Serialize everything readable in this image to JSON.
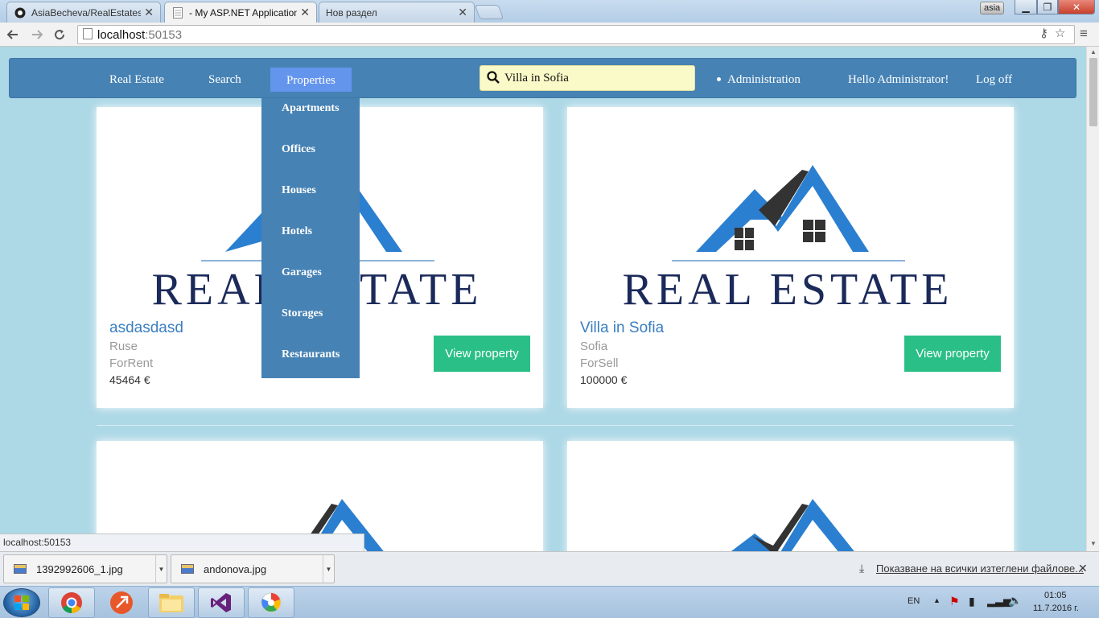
{
  "browser": {
    "tabs": [
      {
        "label": "AsiaBecheva/RealEstates -",
        "active": false
      },
      {
        "label": "- My ASP.NET Application",
        "active": true
      },
      {
        "label": "Нов раздел",
        "active": false
      }
    ],
    "user_badge": "asia",
    "url_host": "localhost",
    "url_port": ":50153"
  },
  "nav": {
    "brand": "Real Estate",
    "search": "Search",
    "properties": "Properties",
    "search_value": "Villa in Sofia",
    "administration": "Administration",
    "hello": "Hello Administrator!",
    "logoff": "Log off"
  },
  "dropdown": [
    "Apartments",
    "Offices",
    "Houses",
    "Hotels",
    "Garages",
    "Storages",
    "Restaurants"
  ],
  "logo_text": "REAL ESTATE",
  "cards": [
    {
      "title": "asdasdasd",
      "city": "Ruse",
      "type": "ForRent",
      "price": "45464 €",
      "button": "View property"
    },
    {
      "title": "Villa in Sofia",
      "city": "Sofia",
      "type": "ForSell",
      "price": "100000 €",
      "button": "View property"
    }
  ],
  "status_url": "localhost:50153",
  "downloads": [
    {
      "name": "1392992606_1.jpg"
    },
    {
      "name": "andonova.jpg"
    }
  ],
  "show_all_downloads": "Показване на всички изтеглени файлове...",
  "taskbar": {
    "lang": "EN",
    "time": "01:05",
    "date": "11.7.2016 г."
  },
  "colors": {
    "page_bg": "#add8e6",
    "navbar": "#4682b4",
    "nav_active": "#6495ed",
    "button": "#2bbf88",
    "title_link": "#3a7fc1"
  }
}
